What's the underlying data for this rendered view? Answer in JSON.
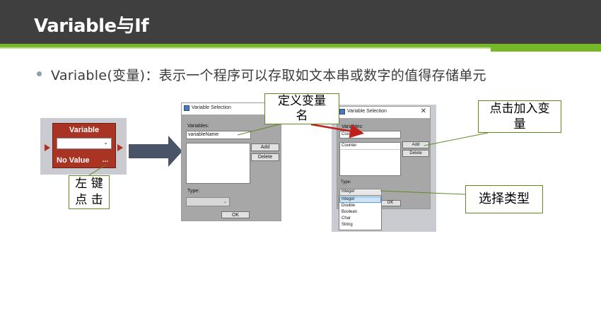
{
  "header": {
    "title": "Variable与If"
  },
  "bullet": {
    "text": "Variable(变量)：表示一个程序可以存取如文本串或数字的值得存储单元"
  },
  "block": {
    "title": "Variable",
    "value": "No Value",
    "dots": "..."
  },
  "callouts": {
    "left_click_line1": "左 键",
    "left_click_line2": "点 击",
    "define_name_line1": "定义变量",
    "define_name_line2": "名",
    "click_add_line1": "点击加入变",
    "click_add_line2": "量",
    "choose_type": "选择类型"
  },
  "dialog1": {
    "title": "Variable Selection",
    "variables_label": "Variables:",
    "variable_input": "variableName",
    "add": "Add",
    "delete": "Delete",
    "type_label": "Type:",
    "ok": "OK"
  },
  "dialog2": {
    "title": "Variable Selection",
    "variables_label": "Variables:",
    "variable_input": "Counter",
    "list_item": "Counter",
    "add": "Add",
    "delete": "Delete",
    "type_label": "Type:",
    "type_selected": "Integer",
    "ok": "OK",
    "type_options": [
      "Integer",
      "Double",
      "Boolean",
      "Char",
      "String"
    ]
  },
  "colors": {
    "header_bg": "#3f3f3f",
    "accent_green": "#76b82a",
    "block_red": "#a93424",
    "arrow_navy": "#4a5468",
    "red_arrow": "#c0201a"
  },
  "icons": {
    "close": "close-icon",
    "chevron": "chevron-down-icon",
    "window": "window-icon"
  }
}
